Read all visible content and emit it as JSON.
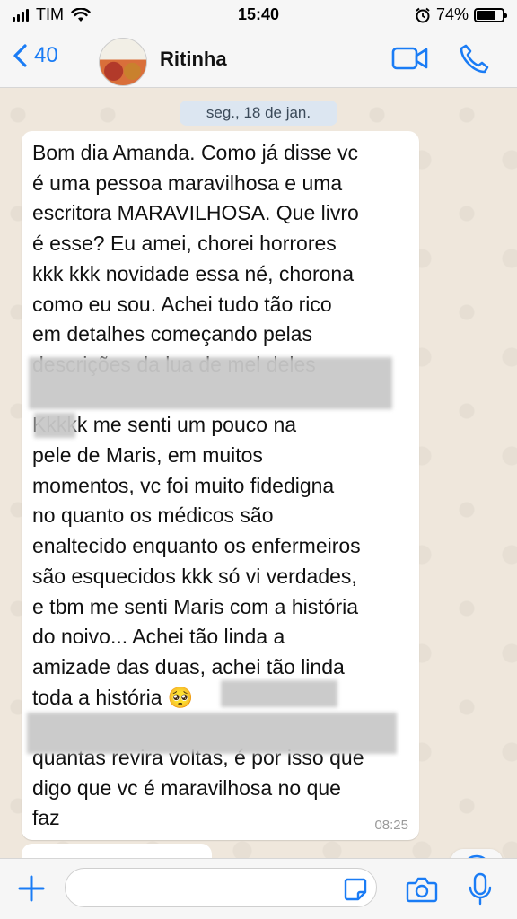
{
  "status_bar": {
    "carrier": "TIM",
    "time": "15:40",
    "battery": "74%",
    "battery_level": 0.74
  },
  "header": {
    "back_count": "40",
    "contact_name": "Ritinha"
  },
  "chat": {
    "date_label": "seg., 18 de jan.",
    "message": {
      "lines": [
        "Bom dia Amanda. Como já disse vc",
        "é uma pessoa maravilhosa e uma",
        "escritora MARAVILHOSA. Que livro",
        "é esse? Eu amei, chorei horrores",
        "kkk kkk novidade essa né, chorona",
        "como eu sou. Achei tudo tão rico",
        "em detalhes começando pelas",
        "descrições da lua de mel deles",
        "",
        "Kkkkk me senti um pouco na",
        "pele de Maris, em muitos",
        "momentos, vc foi muito fidedigna",
        "no quanto os médicos são",
        "enaltecido enquanto os enfermeiros",
        "são esquecidos kkk só vi verdades,",
        "e tbm me senti Maris com a história",
        "do noivo... Achei tão linda a",
        "amizade das duas, achei tão linda",
        "toda a história 🥺",
        "",
        "quantas revira voltas, é por isso que",
        "digo que vc é maravilhosa no que",
        "faz"
      ],
      "time": "08:25"
    }
  },
  "composer": {
    "placeholder": ""
  },
  "colors": {
    "accent": "#1a7cf5",
    "bubble": "#ffffff",
    "date_pill": "#dce6f1"
  }
}
